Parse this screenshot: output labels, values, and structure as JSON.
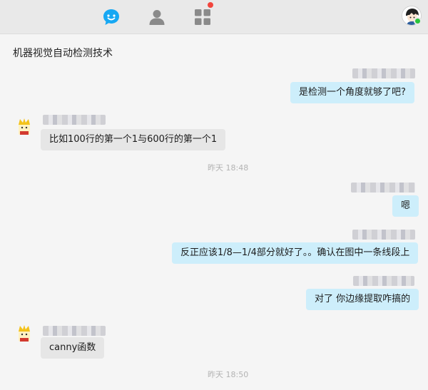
{
  "nav": {
    "chat_icon": "chat-bubble-icon",
    "contacts_icon": "person-icon",
    "apps_icon": "grid-icon",
    "accent": "#17a8f3"
  },
  "chat": {
    "title": "机器视觉自动检测技术"
  },
  "messages": [
    {
      "direction": "out",
      "text": "是检测一个角度就够了吧?"
    },
    {
      "direction": "in",
      "text": "比如100行的第一个1与600行的第一个1"
    },
    {
      "type": "time",
      "text": "昨天  18:48"
    },
    {
      "direction": "out",
      "text": "嗯"
    },
    {
      "direction": "out",
      "text": "反正应该1/8—1/4部分就好了。。确认在图中一条线段上"
    },
    {
      "direction": "out",
      "text": "对了 你边缘提取咋搞的"
    },
    {
      "direction": "in",
      "text": "canny函数"
    },
    {
      "type": "time",
      "text": "昨天  18:50"
    }
  ]
}
